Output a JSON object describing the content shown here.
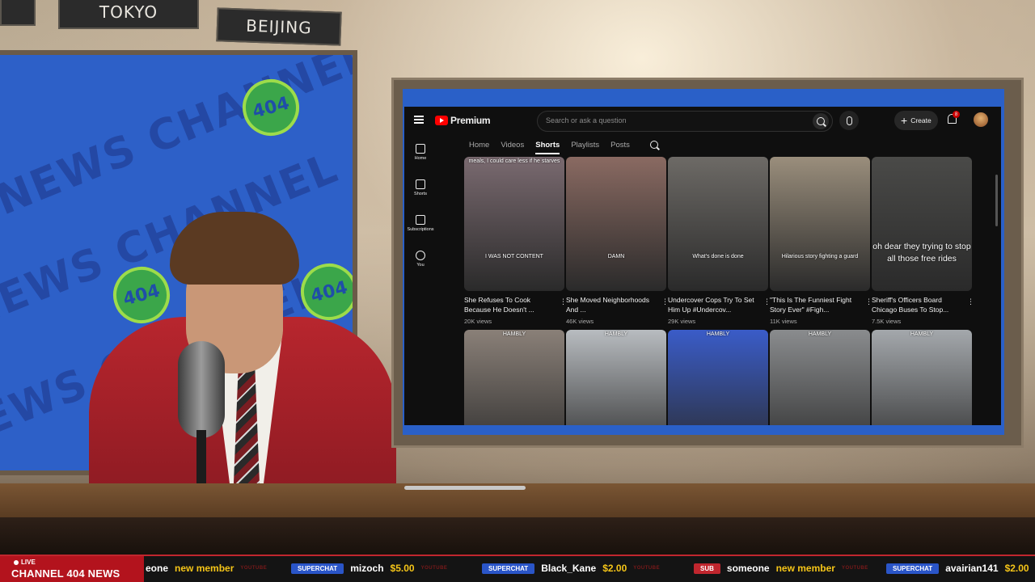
{
  "studio": {
    "city_signs": [
      "TOKYO",
      "BEIJING"
    ],
    "watermark_text": "NEWS CHANNEL",
    "badge_text": "404"
  },
  "youtube": {
    "logo_text": "Premium",
    "search_placeholder": "Search or ask a question",
    "create_label": "Create",
    "notification_count": "8",
    "sidebar": [
      {
        "label": "Home",
        "icon": "home-icon"
      },
      {
        "label": "Shorts",
        "icon": "shorts-icon"
      },
      {
        "label": "Subscriptions",
        "icon": "subscriptions-icon"
      },
      {
        "label": "You",
        "icon": "you-icon"
      }
    ],
    "tabs": [
      "Home",
      "Videos",
      "Shorts",
      "Playlists",
      "Posts"
    ],
    "active_tab": "Shorts",
    "shorts": [
      {
        "title": "She Refuses To Cook Because He Doesn't ...",
        "views": "20K views",
        "caption_top": "meals, I could care less if he starves",
        "caption_mid": "I WAS NOT CONTENT",
        "color": "#7a6a70"
      },
      {
        "title": "She Moved Neighborhoods And ...",
        "views": "46K views",
        "caption_mid": "DAMN",
        "color": "#8a6a62"
      },
      {
        "title": "Undercover Cops Try To Set Him Up #Undercov...",
        "views": "29K views",
        "caption_mid": "What's done is done",
        "color": "#6d6a66"
      },
      {
        "title": "\"This Is The Funniest Fight Story Ever\" #Figh...",
        "views": "11K views",
        "caption_mid": "Hilarious story fighting a guard",
        "color": "#9a8e7c"
      },
      {
        "title": "Sheriff's Officers Board Chicago Buses To Stop...",
        "views": "7.5K views",
        "caption_big": "oh dear they trying to stop all those free rides",
        "color": "#4a4a48"
      },
      {
        "title": "",
        "views": "",
        "caption_top": "HAMBLY",
        "color": "#8a8078"
      },
      {
        "title": "",
        "views": "",
        "caption_top": "HAMBLY",
        "color": "#b8bcc0"
      },
      {
        "title": "",
        "views": "",
        "caption_top": "HAMBLY",
        "color": "#3a5cc8"
      },
      {
        "title": "",
        "views": "",
        "caption_top": "HAMBLY",
        "color": "#8a8c8e"
      },
      {
        "title": "",
        "views": "",
        "caption_top": "HAMBLY",
        "color": "#a4a8ac"
      }
    ]
  },
  "ticker": {
    "live_label": "LIVE",
    "channel_name": "CHANNEL 404 NEWS",
    "items": [
      {
        "badge": "",
        "user": "eone",
        "value": "new member",
        "source": "YOUTUBE"
      },
      {
        "badge": "SUPERCHAT",
        "user": "mizoch",
        "value": "$5.00",
        "source": "YOUTUBE"
      },
      {
        "badge": "SUPERCHAT",
        "user": "Black_Kane",
        "value": "$2.00",
        "source": "YOUTUBE"
      },
      {
        "badge": "SUB",
        "user": "someone",
        "value": "new member",
        "source": "YOUTUBE"
      },
      {
        "badge": "SUPERCHAT",
        "user": "avairian141",
        "value": "$2.00",
        "source": ""
      }
    ],
    "colors": {
      "superchat": "#2a55c8",
      "sub": "#c0262e",
      "value": "#f5c518"
    }
  }
}
